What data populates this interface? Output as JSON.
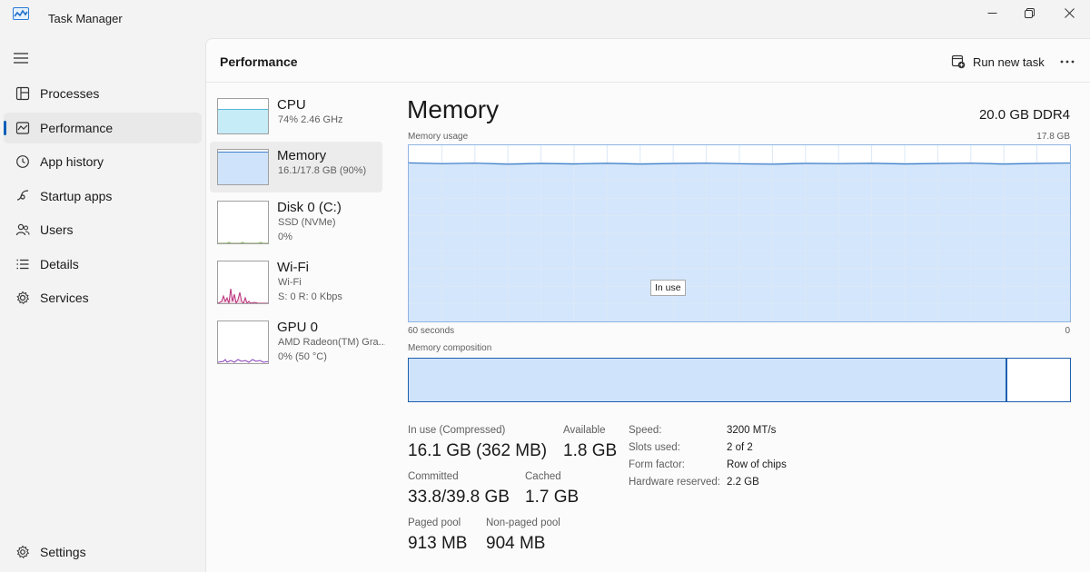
{
  "window": {
    "title": "Task Manager"
  },
  "nav": {
    "items": [
      {
        "label": "Processes",
        "icon": "processes-icon"
      },
      {
        "label": "Performance",
        "icon": "performance-icon",
        "active": true
      },
      {
        "label": "App history",
        "icon": "app-history-icon"
      },
      {
        "label": "Startup apps",
        "icon": "startup-apps-icon"
      },
      {
        "label": "Users",
        "icon": "users-icon"
      },
      {
        "label": "Details",
        "icon": "details-icon"
      },
      {
        "label": "Services",
        "icon": "services-icon"
      }
    ],
    "settings_label": "Settings"
  },
  "header": {
    "title": "Performance",
    "run_task_label": "Run new task"
  },
  "devices": [
    {
      "name": "CPU",
      "sub1": "74%  2.46 GHz",
      "sub2": ""
    },
    {
      "name": "Memory",
      "sub1": "16.1/17.8 GB (90%)",
      "sub2": "",
      "active": true
    },
    {
      "name": "Disk 0 (C:)",
      "sub1": "SSD (NVMe)",
      "sub2": "0%"
    },
    {
      "name": "Wi-Fi",
      "sub1": "Wi-Fi",
      "sub2": "S: 0  R: 0 Kbps"
    },
    {
      "name": "GPU 0",
      "sub1": "AMD Radeon(TM) Gra...",
      "sub2": "0%  (50 °C)"
    }
  ],
  "detail": {
    "title": "Memory",
    "spec": "20.0 GB DDR4",
    "usage_label": "Memory usage",
    "usage_max": "17.8 GB",
    "axis_left": "60 seconds",
    "axis_right": "0",
    "tooltip": "In use",
    "composition_label": "Memory composition",
    "usage_fraction": 0.9,
    "composition_in_use_fraction": 0.905,
    "colors": {
      "fill": "#cfe3fb",
      "line": "#3f7fc9",
      "border": "#1e5fb0",
      "grid": "#dbe8f7"
    },
    "stats": {
      "in_use_label": "In use (Compressed)",
      "in_use_value": "16.1 GB (362 MB)",
      "available_label": "Available",
      "available_value": "1.8 GB",
      "committed_label": "Committed",
      "committed_value": "33.8/39.8 GB",
      "cached_label": "Cached",
      "cached_value": "1.7 GB",
      "paged_label": "Paged pool",
      "paged_value": "913 MB",
      "nonpaged_label": "Non-paged pool",
      "nonpaged_value": "904 MB"
    },
    "specs": [
      {
        "k": "Speed:",
        "v": "3200 MT/s"
      },
      {
        "k": "Slots used:",
        "v": "2 of 2"
      },
      {
        "k": "Form factor:",
        "v": "Row of chips"
      },
      {
        "k": "Hardware reserved:",
        "v": "2.2 GB"
      }
    ]
  }
}
